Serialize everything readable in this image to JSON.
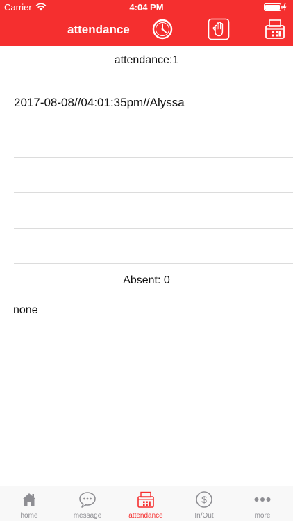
{
  "status_bar": {
    "carrier": "Carrier",
    "time": "4:04 PM"
  },
  "nav": {
    "title": "attendance",
    "icons": [
      "clock-icon",
      "hand-icon",
      "scanner-icon"
    ]
  },
  "attendance": {
    "title": "attendance:1",
    "records": [
      "2017-08-08//04:01:35pm//Alyssa",
      "",
      "",
      "",
      ""
    ]
  },
  "absent": {
    "title": "Absent: 0",
    "list_text": "none"
  },
  "tabs": [
    {
      "label": "home",
      "icon": "home-icon",
      "active": false
    },
    {
      "label": "message",
      "icon": "chat-bubble-icon",
      "active": false
    },
    {
      "label": "attendance",
      "icon": "scanner-icon",
      "active": true
    },
    {
      "label": "In/Out",
      "icon": "dollar-coin-icon",
      "active": false
    },
    {
      "label": "more",
      "icon": "more-dots-icon",
      "active": false
    }
  ],
  "colors": {
    "accent": "#f52f2f",
    "inactive_tab": "#8e8e93",
    "divider": "#dcdcdc"
  }
}
